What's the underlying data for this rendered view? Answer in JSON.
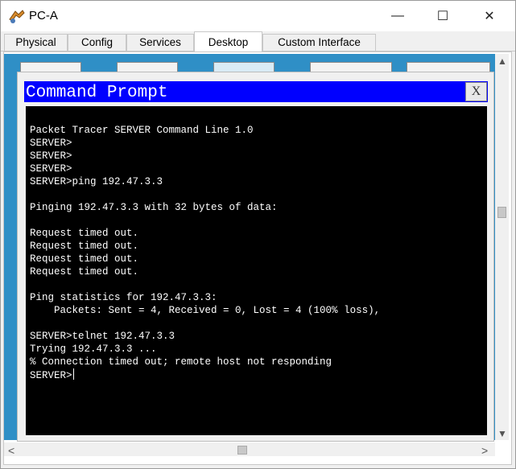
{
  "window": {
    "title": "PC-A",
    "minimize_glyph": "—",
    "maximize_glyph": "☐",
    "close_glyph": "✕"
  },
  "tabs": [
    {
      "label": "Physical"
    },
    {
      "label": "Config"
    },
    {
      "label": "Services"
    },
    {
      "label": "Desktop",
      "active": true
    },
    {
      "label": "Custom Interface"
    }
  ],
  "command_prompt": {
    "title": "Command Prompt",
    "close_label": "X"
  },
  "terminal": {
    "lines": [
      "Packet Tracer SERVER Command Line 1.0",
      "SERVER>",
      "SERVER>",
      "SERVER>",
      "SERVER>ping 192.47.3.3",
      "",
      "Pinging 192.47.3.3 with 32 bytes of data:",
      "",
      "Request timed out.",
      "Request timed out.",
      "Request timed out.",
      "Request timed out.",
      "",
      "Ping statistics for 192.47.3.3:",
      "    Packets: Sent = 4, Received = 0, Lost = 4 (100% loss),",
      "",
      "SERVER>telnet 192.47.3.3",
      "Trying 192.47.3.3 ...",
      "% Connection timed out; remote host not responding",
      "SERVER>"
    ]
  },
  "scrollbars": {
    "up": "▲",
    "down": "▼",
    "left": "<",
    "right": ">"
  },
  "colors": {
    "header_blue": "#0000ff",
    "terminal_bg": "#000000",
    "terminal_fg": "#ffffff",
    "desktop_bg": "#2f8fc6"
  },
  "icons": [
    "packet-tracer-app-icon"
  ]
}
